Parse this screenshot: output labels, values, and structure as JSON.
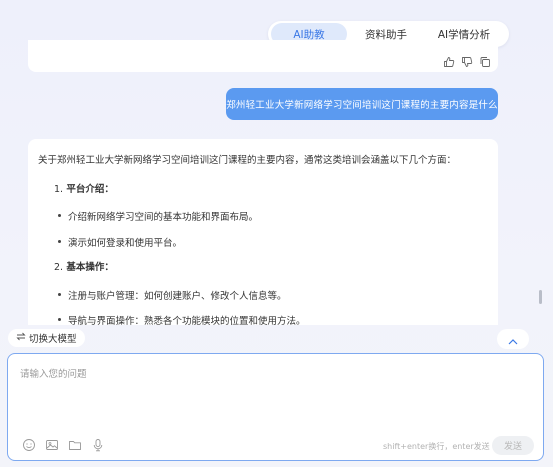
{
  "tabs": [
    {
      "label": "AI助教",
      "active": true
    },
    {
      "label": "资料助手",
      "active": false
    },
    {
      "label": "AI学情分析",
      "active": false
    }
  ],
  "colors": {
    "accent": "#3a78e6",
    "user_bubble": "#5b9af0",
    "input_border": "#7ea9f0"
  },
  "feedback_icons": [
    "thumbs-up-icon",
    "thumbs-down-icon",
    "copy-icon"
  ],
  "user_message": "郑州轻工业大学新网络学习空间培训这门课程的主要内容是什么",
  "answer": {
    "intro": "关于郑州轻工业大学新网络学习空间培训这门课程的主要内容，通常这类培训会涵盖以下几个方面：",
    "sections": [
      {
        "number": "1.",
        "title": "平台介绍：",
        "bullets": [
          "介绍新网络学习空间的基本功能和界面布局。",
          "演示如何登录和使用平台。"
        ]
      },
      {
        "number": "2.",
        "title": "基本操作：",
        "bullets": [
          "注册与账户管理：如何创建账户、修改个人信息等。",
          "导航与界面操作：熟悉各个功能模块的位置和使用方法。"
        ]
      }
    ]
  },
  "model_switch": {
    "icon": "switch-arrows-icon",
    "label": "切换大模型"
  },
  "input": {
    "placeholder": "请输入您的问题",
    "value": "",
    "hint": "shift+enter换行，enter发送",
    "send_label": "发送"
  },
  "toolbar_icons": [
    "emoji-icon",
    "image-icon",
    "folder-icon",
    "microphone-icon"
  ]
}
